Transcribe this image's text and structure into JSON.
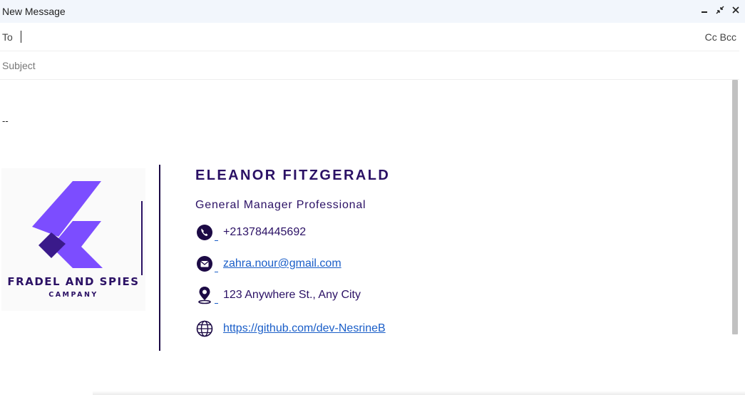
{
  "window": {
    "title": "New Message",
    "controls": [
      "minimize-icon",
      "exit-fullscreen-icon",
      "close-icon"
    ]
  },
  "to": {
    "label": "To",
    "value": ""
  },
  "cc_bcc": {
    "cc": "Cc",
    "bcc": "Bcc"
  },
  "subject": {
    "placeholder": "Subject",
    "value": ""
  },
  "body": {
    "separator": "--",
    "signature": {
      "logo": {
        "brand": "FRADEL AND SPIES",
        "sub": "CAMPANY"
      },
      "name": "ELEANOR FITZGERALD",
      "role": "General Manager Professional",
      "phone": "+213784445692",
      "email": "zahra.nour@gmail.com",
      "address": "123 Anywhere St., Any City",
      "website": "https://github.com/dev-NesrineB"
    }
  },
  "colors": {
    "accent": "#2b1165",
    "link": "#1a5ec8",
    "titlebar_bg": "#f2f6fc",
    "logo_purple": "#7c4dff"
  }
}
